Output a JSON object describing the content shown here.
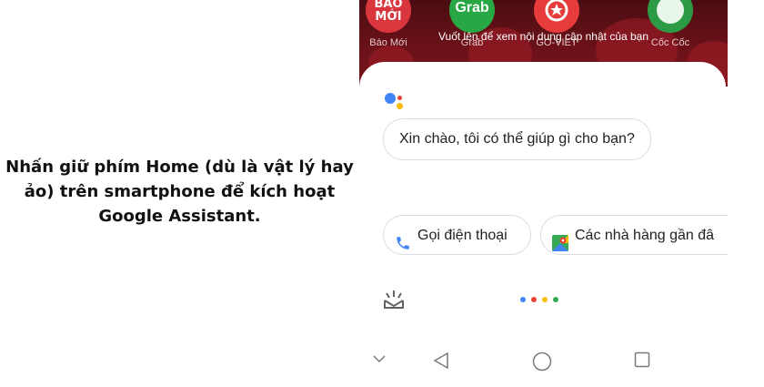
{
  "caption": {
    "line1": "Nhấn giữ phím Home (dù là vật lý hay",
    "line2": "ảo) trên smartphone để kích hoạt",
    "line3": "Google Assistant."
  },
  "home_screen": {
    "apps": [
      {
        "label": "Báo Mới",
        "icon_text_1": "BÁO",
        "icon_text_2": "MỚI",
        "color": "#d9363e"
      },
      {
        "label": "Grab",
        "icon_text_1": "Grab",
        "color": "#27a844"
      },
      {
        "label": "GO-VIET",
        "color": "#e53b3b"
      },
      {
        "label": "Cốc Cốc",
        "color": "#2d9a46"
      }
    ],
    "swipe_hint": "Vuốt lên để xem nội dung cập nhật của bạn"
  },
  "assistant": {
    "greeting": "Xin chào, tôi có thể giúp gì cho bạn?",
    "suggestions": [
      {
        "label": "Gọi điện thoại",
        "icon": "phone-icon"
      },
      {
        "label": "Các nhà hàng gần đâ",
        "icon": "maps-icon"
      }
    ],
    "brand_colors": {
      "blue": "#4285f4",
      "red": "#ea4335",
      "yellow": "#fbbc05",
      "green": "#34a853"
    }
  },
  "navbar": {
    "buttons": [
      "collapse-icon",
      "back-icon",
      "home-icon",
      "recents-icon"
    ]
  }
}
